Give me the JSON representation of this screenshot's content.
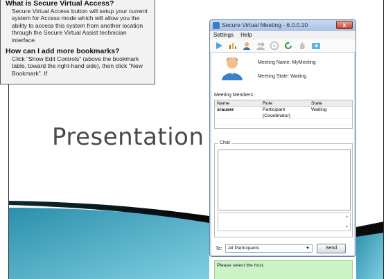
{
  "slide": {
    "title": "Presentation"
  },
  "help": {
    "q1": "What is Secure Virtual Access?",
    "a1": "Secure Virtual Access button will setup your current system for Access mode which will allow you the ability to access this system from another location through the Secure Virtual Assist technician interface.",
    "q2": "How can I add more bookmarks?",
    "a2": "Click \"Show Edit Controls\" (above the bookmark table, toward the right-hand side), then click \"New Bookmark\". If"
  },
  "window": {
    "title": "Secure Virtual Meeting - 6.0.0.10",
    "close": "x",
    "menu": [
      "Settings",
      "Help"
    ],
    "toolbar_icons": [
      "play-icon",
      "chart-icon",
      "user-icon",
      "group-icon",
      "disc-icon",
      "refresh-icon",
      "hand-icon",
      "share-icon"
    ]
  },
  "meeting": {
    "name_label": "Meeting Name:",
    "name_value": "MyMeeting",
    "state_label": "Meeting State:",
    "state_value": "Waiting",
    "members_label": "Meeting Members:"
  },
  "members_table": {
    "headers": [
      "Name",
      "Role",
      "State"
    ],
    "rows": [
      [
        "srauser",
        "Participant (Coordinator)",
        "Waiting"
      ]
    ]
  },
  "chat": {
    "label": "Chat",
    "to_label": "To:",
    "recipient": "All Participants",
    "send": "Send"
  },
  "status": {
    "message": "Please select the host."
  },
  "colors": {
    "accent_blue": "#3c7cc8",
    "status_green": "#cbf3c6",
    "wave_dark": "#1b5f74",
    "wave_light": "#3aa6c2"
  }
}
